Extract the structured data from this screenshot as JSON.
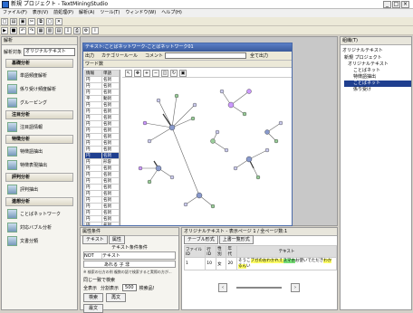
{
  "window": {
    "title": "新規 プロジェクト - TextMiningStudio"
  },
  "menubar": [
    "ファイル(F)",
    "表示(V)",
    "前処理(P)",
    "解析(A)",
    "ツール(T)",
    "ウィンドウ(W)",
    "ヘルプ(H)"
  ],
  "left_panel": {
    "title": "解析",
    "target_label": "解析対象",
    "target_value": "オリジナルテキスト",
    "sections": [
      {
        "title": "基礎分析",
        "items": [
          "単語頻度解析",
          "係り受け頻度解析",
          "グルーピング"
        ]
      },
      {
        "title": "注目分析",
        "items": [
          "注目語情報"
        ]
      },
      {
        "title": "特徴分析",
        "items": [
          "特徴語抽出",
          "特徴表現抽出"
        ]
      },
      {
        "title": "評判分析",
        "items": [
          "評判抽出"
        ]
      },
      {
        "title": "連想分析",
        "items": [
          "ことばネットワーク",
          "対応バブル分析",
          "文書分類"
        ]
      }
    ]
  },
  "network_window": {
    "title": "テキスト:ことばネットワーク-ことばネットワーク01",
    "toolbar": {
      "output_label": "出力",
      "category_label": "カテゴリールール",
      "comment_label": "コメント",
      "display_all_label": "全て出力"
    },
    "sub_label": "ワード数",
    "table": {
      "headers": [
        "情報",
        "単語"
      ],
      "rows": [
        [
          "円",
          "名詞"
        ],
        [
          "円",
          "名詞"
        ],
        [
          "円",
          "名詞"
        ],
        [
          "平",
          "動詞"
        ],
        [
          "円",
          "名詞"
        ],
        [
          "円",
          "名詞"
        ],
        [
          "円",
          "名詞"
        ],
        [
          "円",
          "名詞"
        ],
        [
          "円",
          "名詞"
        ],
        [
          "円",
          "名詞"
        ],
        [
          "円",
          "名詞"
        ],
        [
          "円",
          "名詞"
        ],
        [
          "円",
          "名詞"
        ],
        [
          "円",
          "形容"
        ],
        [
          "円",
          "名詞"
        ],
        [
          "円",
          "名詞"
        ],
        [
          "円",
          "名詞"
        ],
        [
          "円",
          "名詞"
        ],
        [
          "円",
          "名詞"
        ],
        [
          "円",
          "名詞"
        ],
        [
          "円",
          "名詞"
        ],
        [
          "円",
          "名詞"
        ],
        [
          "円",
          "名詞"
        ],
        [
          "円",
          "名詞"
        ],
        [
          "円",
          "名詞"
        ]
      ],
      "selected_index": 12
    }
  },
  "right_panel": {
    "title": "組織(T)",
    "subtitle": "オリジナルテキスト",
    "tree": [
      "新規 プロジェクト",
      "オリジナルテキスト",
      "ことばネット",
      "特徴語抽出",
      "ことばネット",
      "係り受け"
    ]
  },
  "bottom_left": {
    "title": "属性条件",
    "tabs": [
      "テキスト",
      "属性"
    ],
    "condition_header": "テキスト条件条件",
    "columns": [
      "NOT",
      "テキスト"
    ],
    "row_value": "あれる 子 非",
    "note": "※ 検索の仕方の例 複数の語で検索すると実際の方が...",
    "all_option": "同じ一致で検索",
    "radio1": "全表示",
    "radio2": "分割表示",
    "page_value": "500",
    "clear_label": "検索品!",
    "search_button": "検索",
    "search_next": "再文",
    "status_button": "最文"
  },
  "bottom_right": {
    "title": "オリジナルテキスト - 表示ページ 1 / 全ページ数:1",
    "tabs": [
      "テーブル形式",
      "上書一覧形式"
    ],
    "headers": [
      "ファイルID",
      "行ID",
      "性別",
      "年代",
      "テキスト"
    ],
    "row": [
      "1",
      "10",
      "女",
      "20",
      "日本語のテキストがありました。..."
    ],
    "text_segments": [
      "そうこ",
      "ブガのお",
      "わかれえ",
      "スマホ",
      "お使いで",
      "ただき",
      "わかるん",
      "い"
    ]
  },
  "status": "属性条件"
}
